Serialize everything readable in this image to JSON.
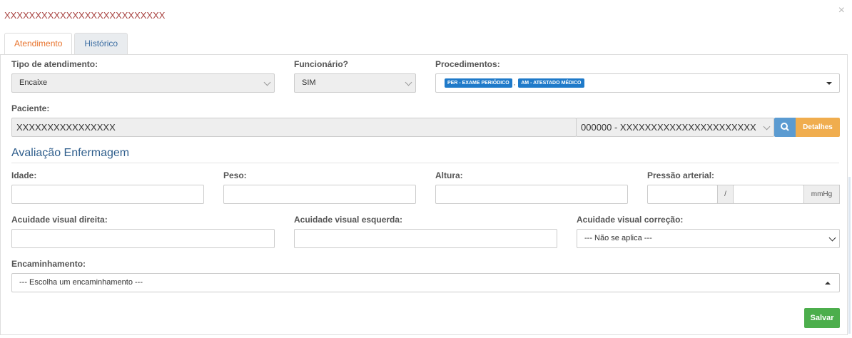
{
  "modal": {
    "title": "XXXXXXXXXXXXXXXXXXXXXXXXXX",
    "close": "×"
  },
  "tabs": [
    {
      "label": "Atendimento",
      "active": true
    },
    {
      "label": "Histórico",
      "active": false
    }
  ],
  "form": {
    "tipo_atendimento": {
      "label": "Tipo de atendimento:",
      "value": "Encaixe"
    },
    "funcionario": {
      "label": "Funcionário?",
      "value": "SIM"
    },
    "procedimentos": {
      "label": "Procedimentos:",
      "tags": [
        "PER - EXAME PERIÓDICO",
        "AM - ATESTADO MÉDICO"
      ],
      "separator": ","
    },
    "paciente": {
      "label": "Paciente:",
      "name": "XXXXXXXXXXXXXXXX",
      "selected": "000000 - XXXXXXXXXXXXXXXXXXXXXX",
      "details_label": "Detalhes"
    },
    "section_title": "Avaliação Enfermagem",
    "idade": {
      "label": "Idade:",
      "value": ""
    },
    "peso": {
      "label": "Peso:",
      "value": ""
    },
    "altura": {
      "label": "Altura:",
      "value": ""
    },
    "pressao": {
      "label": "Pressão arterial:",
      "separator": "/",
      "unit": "mmHg"
    },
    "acuidade_direita": {
      "label": "Acuidade visual direita:",
      "value": ""
    },
    "acuidade_esquerda": {
      "label": "Acuidade visual esquerda:",
      "value": ""
    },
    "acuidade_correcao": {
      "label": "Acuidade visual correção:",
      "value": "--- Não se aplica ---"
    },
    "encaminhamento": {
      "label": "Encaminhamento:",
      "value": "--- Escolha um encaminhamento ---"
    },
    "save_label": "Salvar"
  },
  "colors": {
    "title": "#a94442",
    "active_tab": "#e8732c",
    "tag": "#1f7ac9",
    "search_button": "#5b9bd1",
    "details_button": "#f0ad4e",
    "save_button": "#4cae4c"
  }
}
